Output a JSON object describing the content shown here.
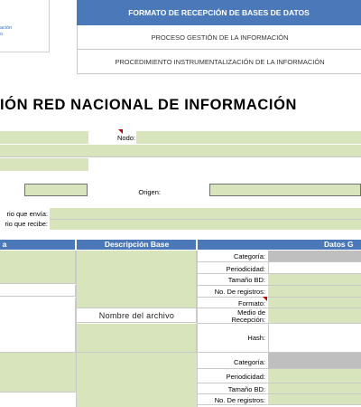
{
  "header": {
    "logo_text": "ación\no",
    "title": "FORMATO DE RECEPCIÓN DE BASES DE DATOS",
    "process": "PROCESO GESTIÓN DE LA INFORMACIÓN",
    "procedure": "PROCEDIMIENTO INSTRUMENTALIZACIÓN DE LA INFORMACIÓN"
  },
  "doc_title": "IÓN RED NACIONAL DE INFORMACIÓN",
  "form": {
    "nodo_label": "Nodo:",
    "origen_label": "Origen:",
    "envia_label": "rio que envía:",
    "recibe_label": "rio que recibe:"
  },
  "table": {
    "col_left": "a",
    "col_desc": "Descripción Base",
    "col_datos": "Datos G",
    "nombre_archivo": "Nombre del archivo",
    "block1": {
      "categoria": "Categoría:",
      "periodicidad": "Periodicidad:",
      "tamano": "Tamaño BD:",
      "registros": "No. De registros:",
      "formato": "Formato:",
      "medio_l1": "Medio de",
      "medio_l2": "Recepción:",
      "hash": "Hash:"
    },
    "block2": {
      "categoria": "Categoría:",
      "periodicidad": "Periodicidad:",
      "tamano": "Tamaño BD:",
      "registros": "No. De registros:"
    }
  },
  "colors": {
    "header_blue": "#4a78b8",
    "form_green": "#d8e4bc",
    "category_gray": "#bfbfbf"
  }
}
